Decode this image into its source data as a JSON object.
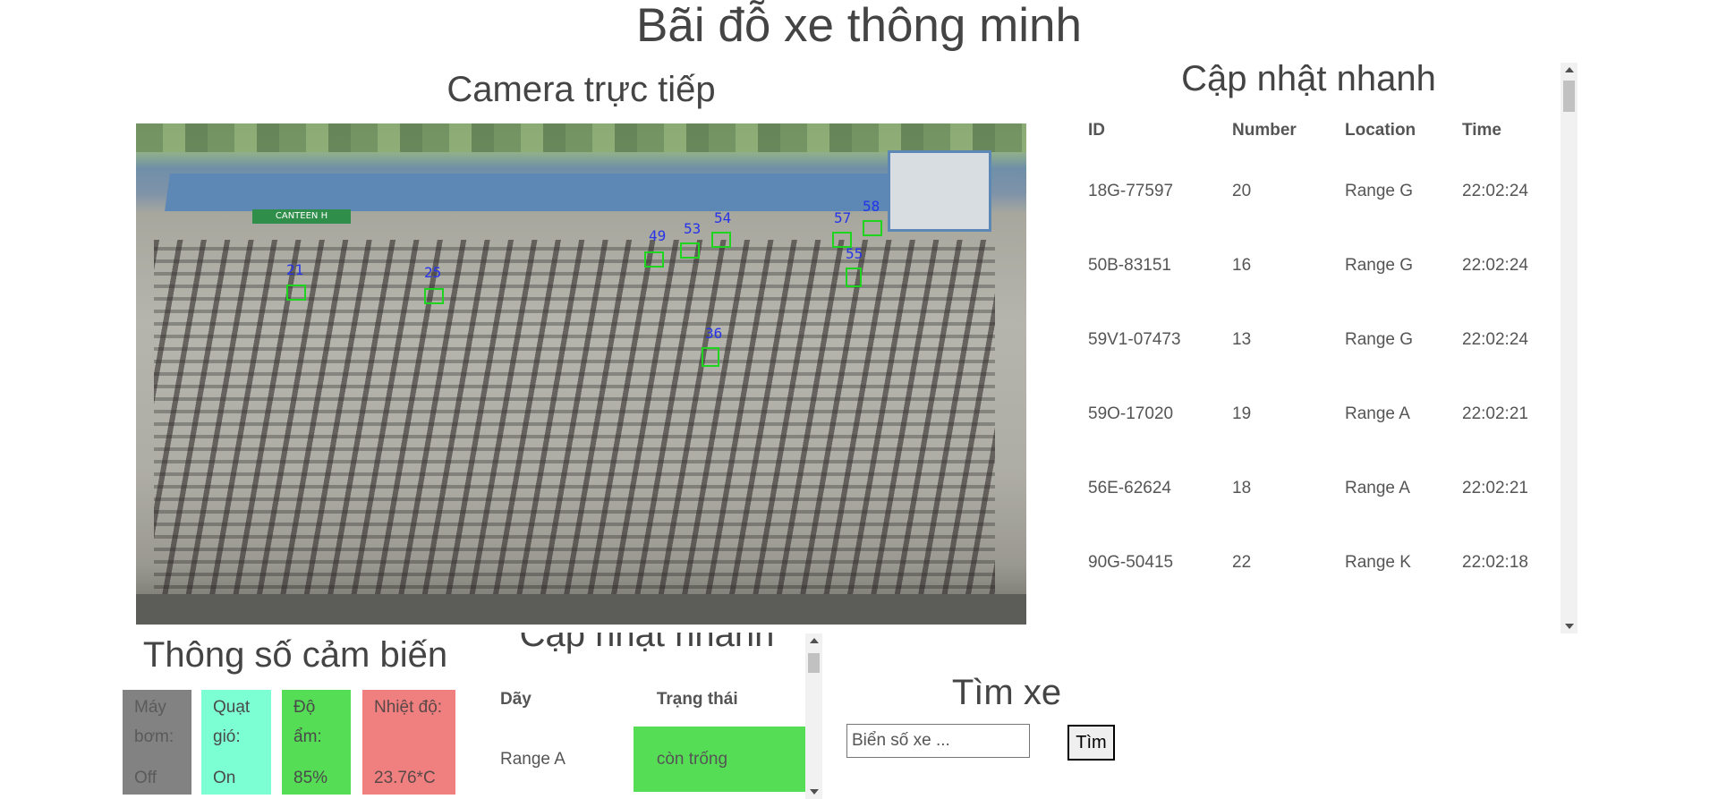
{
  "page": {
    "title": "Bãi đỗ xe thông minh"
  },
  "camera": {
    "title": "Camera trực tiếp",
    "banner": "CANTEEN H",
    "detections": [
      "21",
      "25",
      "49",
      "53",
      "54",
      "57",
      "58",
      "55",
      "36"
    ]
  },
  "quick_update": {
    "title": "Cập nhật nhanh",
    "columns": [
      "ID",
      "Number",
      "Location",
      "Time"
    ],
    "rows": [
      [
        "18G-77597",
        "20",
        "Range G",
        "22:02:24"
      ],
      [
        "50B-83151",
        "16",
        "Range G",
        "22:02:24"
      ],
      [
        "59V1-07473",
        "13",
        "Range G",
        "22:02:24"
      ],
      [
        "59O-17020",
        "19",
        "Range A",
        "22:02:21"
      ],
      [
        "56E-62624",
        "18",
        "Range A",
        "22:02:21"
      ],
      [
        "90G-50415",
        "22",
        "Range K",
        "22:02:18"
      ]
    ]
  },
  "sensors": {
    "title": "Thông số cảm biến",
    "pump": {
      "label": "Máy bơm:",
      "value": "Off",
      "color": "#828282"
    },
    "fan": {
      "label": "Quạt gió:",
      "value": "On",
      "color": "#7dffd4"
    },
    "humidity": {
      "label": "Độ ẩm:",
      "value": "85%",
      "color": "#55dd55"
    },
    "temperature": {
      "label": "Nhiệt độ:",
      "value": "23.76*C",
      "color": "#f08080"
    }
  },
  "range_status": {
    "title": "Cập nhật nhanh",
    "columns": [
      "Dãy",
      "Trạng thái"
    ],
    "rows": [
      [
        "Range A",
        "còn trống"
      ]
    ]
  },
  "search": {
    "title": "Tìm xe",
    "placeholder": "Biển số xe ...",
    "button_label": "Tìm"
  }
}
